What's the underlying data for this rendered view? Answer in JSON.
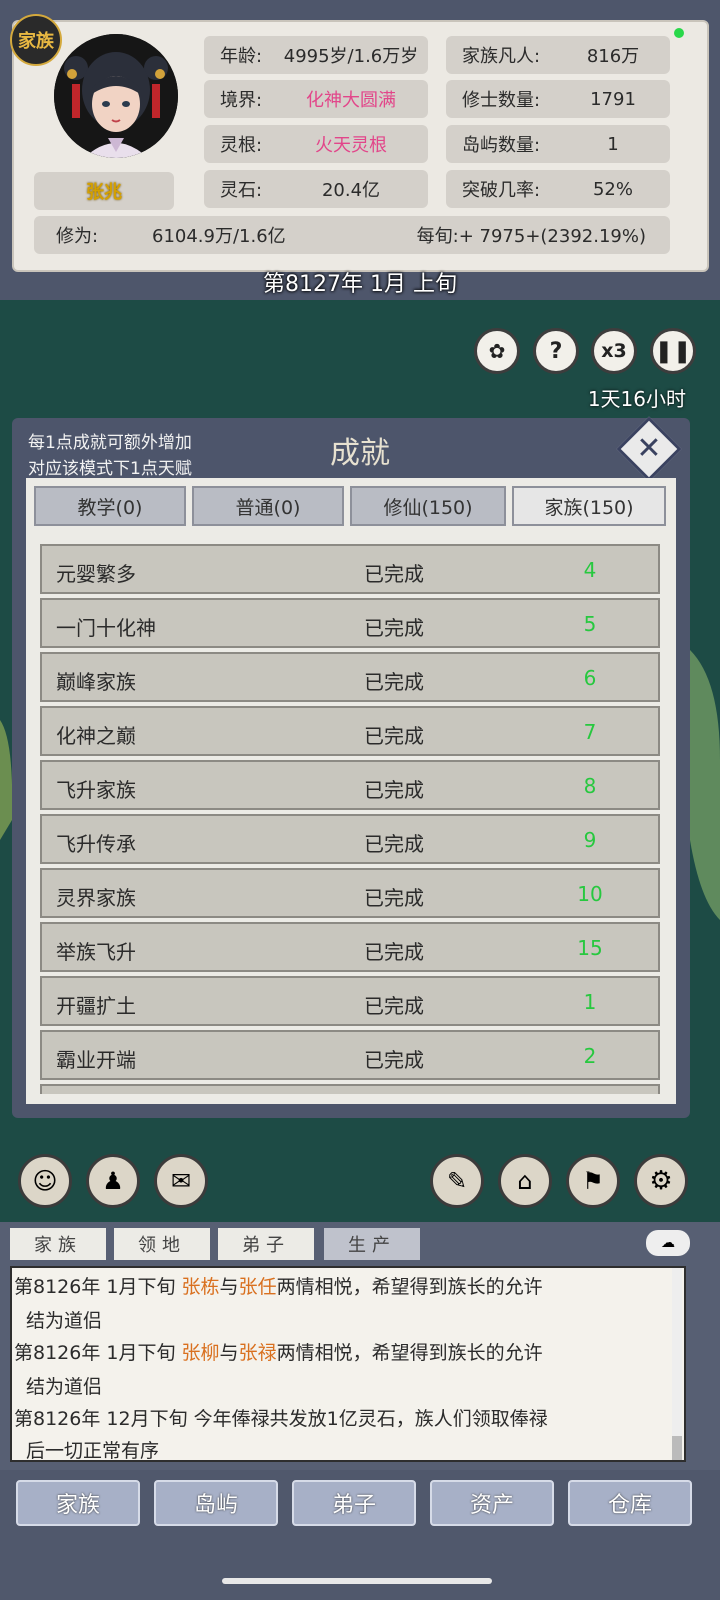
{
  "profile": {
    "badge": "家族",
    "name": "张兆",
    "stats_left": [
      {
        "label": "年龄:",
        "value": "4995岁/1.6万岁",
        "pink": false
      },
      {
        "label": "境界:",
        "value": "化神大圆满",
        "pink": true
      },
      {
        "label": "灵根:",
        "value": "火天灵根",
        "pink": true
      },
      {
        "label": "灵石:",
        "value": "20.4亿",
        "pink": false
      }
    ],
    "stats_right": [
      {
        "label": "家族凡人:",
        "value": "816万"
      },
      {
        "label": "修士数量:",
        "value": "1791"
      },
      {
        "label": "岛屿数量:",
        "value": "1"
      },
      {
        "label": "突破几率:",
        "value": "52%"
      }
    ],
    "cultivation_label": "修为:",
    "cultivation_value": "6104.9万/1.6亿",
    "per_period": "每旬:+ 7975+(2392.19%)"
  },
  "date": "第8127年 1月 上旬",
  "controls": {
    "speed": "x3",
    "help": "?",
    "time_left": "1天16小时"
  },
  "dialog": {
    "title": "成就",
    "note_line1": "每1点成就可额外增加",
    "note_line2": "对应该模式下1点天赋",
    "tabs": [
      "教学(0)",
      "普通(0)",
      "修仙(150)",
      "家族(150)"
    ],
    "active_tab": 3,
    "rows": [
      {
        "name": "元婴繁多",
        "status": "已完成",
        "points": "4"
      },
      {
        "name": "一门十化神",
        "status": "已完成",
        "points": "5"
      },
      {
        "name": "巅峰家族",
        "status": "已完成",
        "points": "6"
      },
      {
        "name": "化神之巅",
        "status": "已完成",
        "points": "7"
      },
      {
        "name": "飞升家族",
        "status": "已完成",
        "points": "8"
      },
      {
        "name": "飞升传承",
        "status": "已完成",
        "points": "9"
      },
      {
        "name": "灵界家族",
        "status": "已完成",
        "points": "10"
      },
      {
        "name": "举族飞升",
        "status": "已完成",
        "points": "15"
      },
      {
        "name": "开疆扩土",
        "status": "已完成",
        "points": "1"
      },
      {
        "name": "霸业开端",
        "status": "已完成",
        "points": "2"
      }
    ]
  },
  "log_tabs": [
    "家族",
    "领地",
    "弟子",
    "生产"
  ],
  "log_active_tab": 3,
  "log": [
    {
      "a": "第8126年 1月下旬 ",
      "n1": "张栋",
      "m": "与",
      "n2": "张任",
      "b": "两情相悦，希望得到族长的允许"
    },
    {
      "a": "结为道侣"
    },
    {
      "a": "第8126年 1月下旬 ",
      "n1": "张柳",
      "m": "与",
      "n2": "张禄",
      "b": "两情相悦，希望得到族长的允许"
    },
    {
      "a": "结为道侣"
    },
    {
      "a": "第8126年 12月下旬 今年俸禄共发放1亿灵石，族人们领取俸禄"
    },
    {
      "a": "后一切正常有序"
    }
  ],
  "nav": [
    "家族",
    "岛屿",
    "弟子",
    "资产",
    "仓库"
  ]
}
